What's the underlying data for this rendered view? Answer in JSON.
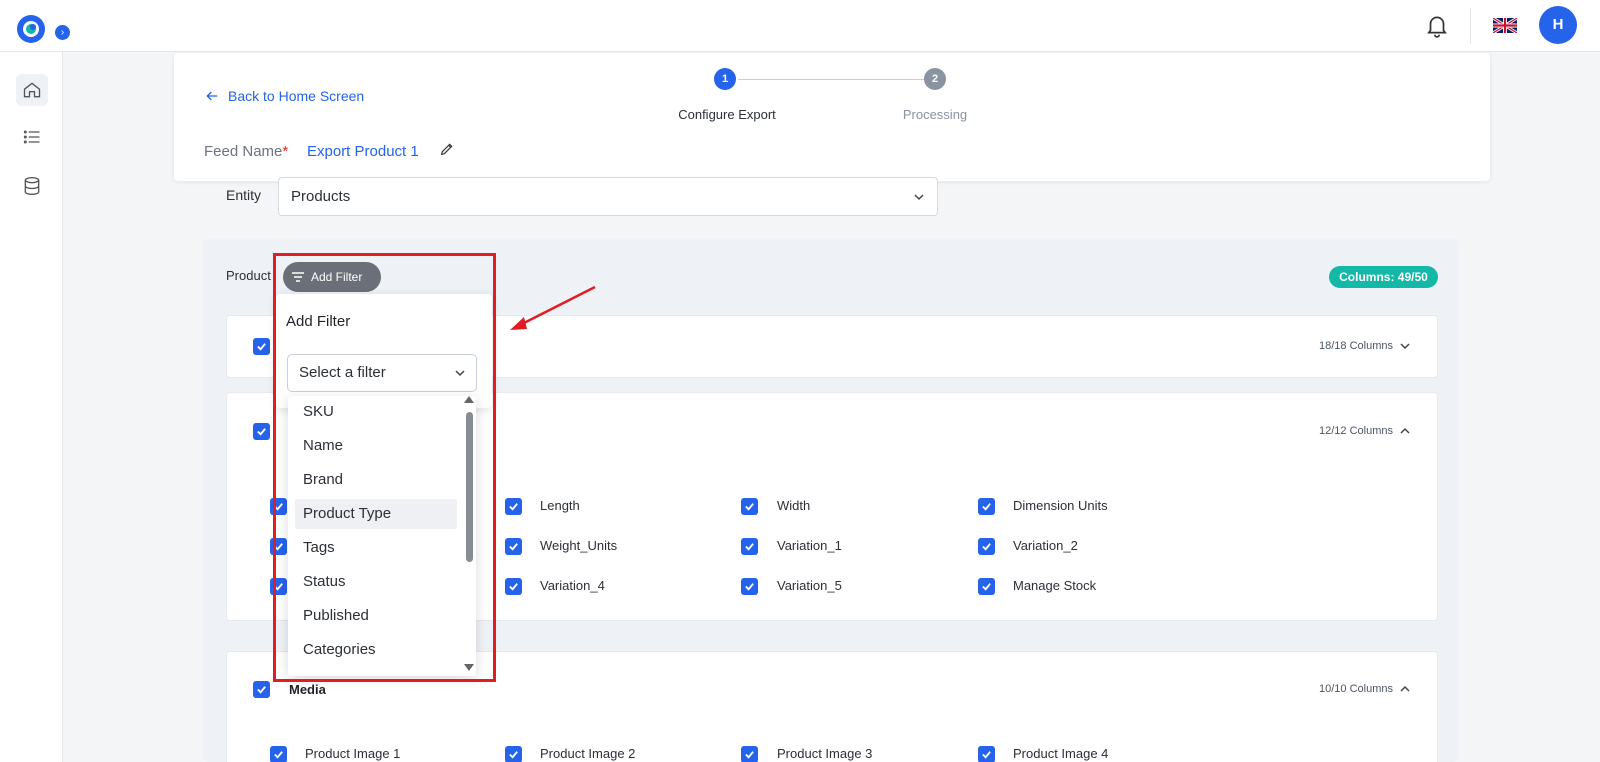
{
  "topbar": {
    "avatar_initial": "H",
    "icons": [
      "logo-icon",
      "bell-icon",
      "uk-flag-icon"
    ]
  },
  "sidebar": {
    "items": [
      {
        "icon": "home-icon",
        "active": true
      },
      {
        "icon": "list-icon",
        "active": false
      },
      {
        "icon": "database-icon",
        "active": false
      }
    ]
  },
  "header": {
    "back_label": "Back to Home Screen",
    "steps": [
      {
        "number": "1",
        "label": "Configure Export",
        "active": true
      },
      {
        "number": "2",
        "label": "Processing",
        "active": false
      }
    ],
    "feed_name_label": "Feed Name",
    "feed_name_required": "*",
    "feed_name_value": "Export Product 1"
  },
  "entity": {
    "label": "Entity",
    "value": "Products"
  },
  "products_section": {
    "label": "Product",
    "add_filter_label": "Add Filter",
    "columns_badge": "Columns: 49/50"
  },
  "groups": [
    {
      "count": "18/18 Columns",
      "expanded": false
    },
    {
      "count": "12/12 Columns",
      "expanded": true,
      "columns": [
        [
          "",
          "Length",
          "Width",
          "Dimension Units"
        ],
        [
          "",
          "Weight_Units",
          "Variation_1",
          "Variation_2"
        ],
        [
          "",
          "Variation_4",
          "Variation_5",
          "Manage Stock"
        ]
      ]
    },
    {
      "title": "Media",
      "count": "10/10 Columns",
      "expanded": true,
      "columns": [
        [
          "Product Image 1",
          "Product Image 2",
          "Product Image 3",
          "Product Image 4"
        ]
      ]
    }
  ],
  "filter_popover": {
    "title": "Add Filter",
    "select_placeholder": "Select a filter",
    "options": [
      "SKU",
      "Name",
      "Brand",
      "Product Type",
      "Tags",
      "Status",
      "Published",
      "Categories"
    ],
    "hovered_option": "Product Type"
  },
  "colors": {
    "accent": "#2563eb",
    "badge": "#14b8a6",
    "annotation": "#e11d24"
  }
}
